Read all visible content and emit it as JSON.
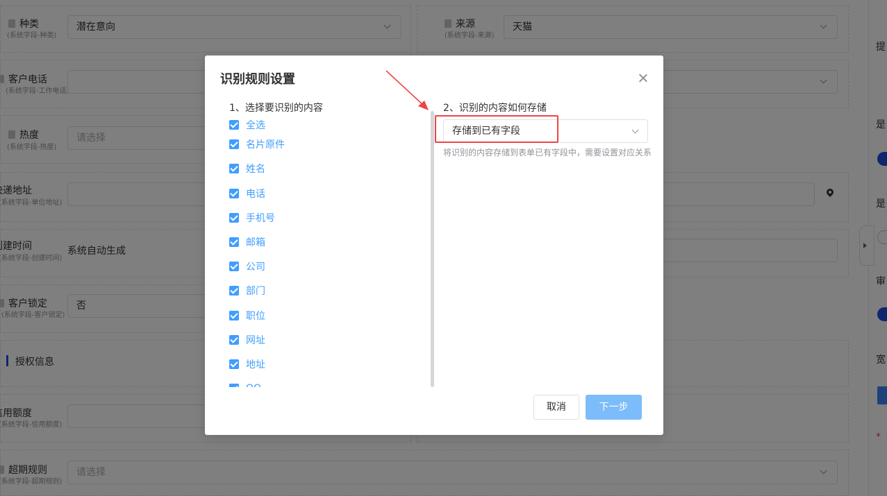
{
  "form": {
    "type": {
      "label": "种类",
      "sub": "(系统字段-种类)",
      "value": "潜在意向"
    },
    "source": {
      "label": "来源",
      "sub": "(系统字段-来源)",
      "value": "天猫"
    },
    "phone": {
      "label": "客户电话",
      "sub": "(系统字段-工作电话)"
    },
    "heat": {
      "label": "热度",
      "sub": "(系统字段-热度)",
      "placeholder": "请选择"
    },
    "address": {
      "label": "快递地址",
      "sub": "(系统字段-单位地址)"
    },
    "created": {
      "label": "创建时间",
      "sub": "(系统字段-创建时间)",
      "value": "系统自动生成"
    },
    "lock": {
      "label": "客户锁定",
      "sub": "(系统字段-客户锁定)",
      "value": "否"
    },
    "section_auth": "授权信息",
    "credit": {
      "label": "信用额度",
      "sub": "(系统字段-信用额度)"
    },
    "overdue": {
      "label": "超期规则",
      "sub": "(系统字段-超期规则)",
      "placeholder": "请选择"
    }
  },
  "right_panel": {
    "chars": [
      "提",
      "是",
      "是",
      "审",
      "宽"
    ],
    "required_mark": "*"
  },
  "dialog": {
    "title": "识别规则设置",
    "step1": "1、选择要识别的内容",
    "step2": "2、识别的内容如何存储",
    "items": [
      "全选",
      "名片原件",
      "姓名",
      "电话",
      "手机号",
      "邮箱",
      "公司",
      "部门",
      "职位",
      "网址",
      "地址",
      "QQ"
    ],
    "storage_value": "存储到已有字段",
    "help": "将识别的内容存储到表单已有字段中，需要设置对应关系",
    "cancel": "取消",
    "next": "下一步"
  },
  "colors": {
    "accent": "#409eff",
    "next_button": "#7dbcfa",
    "highlight": "#ef4444",
    "section": "#1d4ed8"
  }
}
